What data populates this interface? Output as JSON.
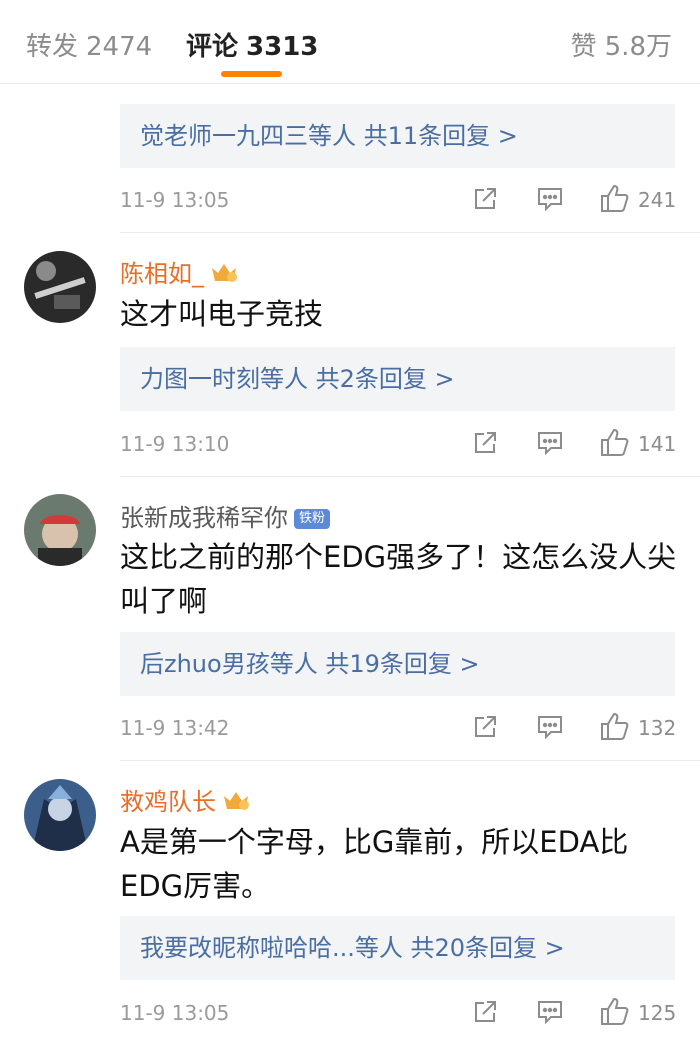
{
  "tabs": {
    "forward_label": "转发",
    "forward_count": "2474",
    "comment_label": "评论",
    "comment_count": "3313",
    "like_label": "赞",
    "like_count": "5.8万"
  },
  "accent_color": "#ff8200",
  "top_reply_preview": "觉老师一九四三等人 共11条回复 >",
  "top_meta": {
    "time": "11-9 13:05",
    "likes": "241"
  },
  "comments": [
    {
      "username": "陈相如_",
      "badge": "crown-vip-icon",
      "text": "这才叫电子竞技",
      "replies": "力图一时刻等人 共2条回复 >",
      "time": "11-9 13:10",
      "likes": "141"
    },
    {
      "username": "张新成我稀罕你",
      "badge_text": "铁粉",
      "text": "这比之前的那个EDG强多了！这怎么没人尖叫了啊",
      "replies": "后zhuo男孩等人 共19条回复 >",
      "time": "11-9 13:42",
      "likes": "132"
    },
    {
      "username": "救鸡队长",
      "badge": "crown-vip-icon",
      "text": "A是第一个字母，比G靠前，所以EDA比EDG厉害。",
      "replies": "我要改昵称啦哈哈...等人 共20条回复 >",
      "time": "11-9 13:05",
      "likes": "125"
    }
  ]
}
